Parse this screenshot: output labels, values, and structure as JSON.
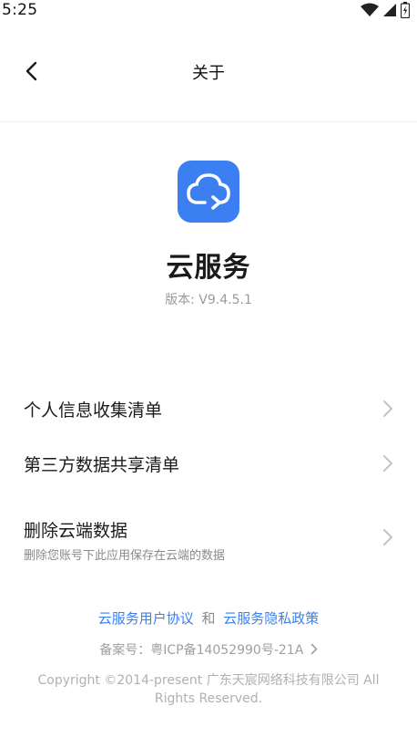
{
  "status_bar": {
    "time": "5:25"
  },
  "header": {
    "title": "关于"
  },
  "app": {
    "name": "云服务",
    "version": "版本: V9.4.5.1"
  },
  "menu": {
    "items": [
      {
        "label": "个人信息收集清单"
      },
      {
        "label": "第三方数据共享清单"
      },
      {
        "label": "删除云端数据",
        "sublabel": "删除您账号下此应用保存在云端的数据"
      }
    ]
  },
  "footer": {
    "user_agreement": "云服务用户协议",
    "and": "和",
    "privacy_policy": "云服务隐私政策",
    "icp": "备案号：粤ICP备14052990号-21A",
    "copyright": "Copyright ©2014-present 广东天宸网络科技有限公司 All Rights Reserved."
  },
  "colors": {
    "accent": "#3b7ff2",
    "text": "#1a1a1a",
    "muted": "#9a9a9a"
  }
}
